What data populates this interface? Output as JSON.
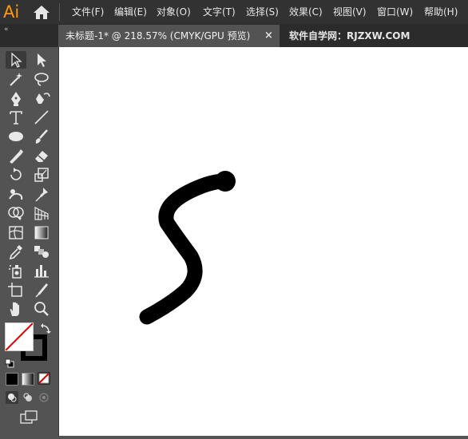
{
  "app": {
    "logo": "Ai"
  },
  "menu": [
    "文件(F)",
    "编辑(E)",
    "对象(O)",
    "文字(T)",
    "选择(S)",
    "效果(C)",
    "视图(V)",
    "窗口(W)",
    "帮助(H)"
  ],
  "tabs": {
    "active_title": "未标题-1* @ 218.57% (CMYK/GPU 预览)",
    "close_glyph": "×",
    "other_title": "软件自学网：RJZXW.COM"
  },
  "toolbar": {
    "collapse_glyph": "«",
    "tools": [
      "selection-tool",
      "direct-selection-tool",
      "magic-wand-tool",
      "lasso-tool",
      "pen-tool",
      "curvature-tool",
      "type-tool",
      "line-segment-tool",
      "ellipse-tool",
      "paintbrush-tool",
      "shaper-tool",
      "eraser-tool",
      "rotate-tool",
      "scale-tool",
      "puppet-warp-tool",
      "pin-tool",
      "shape-builder-tool",
      "perspective-grid-tool",
      "mesh-tool",
      "gradient-tool",
      "eyedropper-tool",
      "blend-tool",
      "symbol-sprayer-tool",
      "column-graph-tool",
      "artboard-tool",
      "slice-tool",
      "hand-tool",
      "zoom-tool"
    ],
    "fill": "none",
    "stroke_color": "#000000"
  },
  "colors": {
    "menubar_bg": "#323232",
    "panel_bg": "#535353",
    "canvas_bg": "#ffffff",
    "logo_color": "#ff9a00",
    "stroke_path": "#000000"
  }
}
